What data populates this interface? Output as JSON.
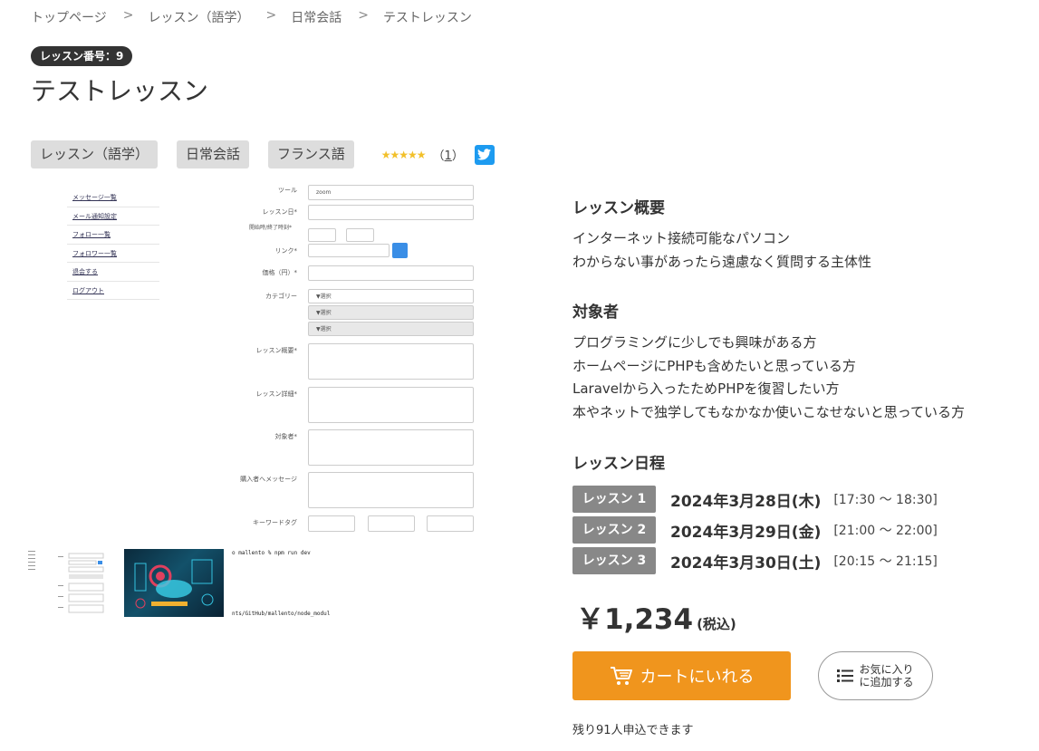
{
  "breadcrumb": [
    "トップページ",
    "レッスン（語学）",
    "日常会話",
    "テストレッスン"
  ],
  "breadcrumb_separator": ">",
  "lesson_number": "レッスン番号：9",
  "title": "テストレッスン",
  "tags": [
    "レッスン（語学）",
    "日常会話",
    "フランス語"
  ],
  "rating": {
    "stars": "★★★★★",
    "score": 5,
    "count_prefix": "（",
    "count": "1",
    "count_suffix": "）"
  },
  "main_image": {
    "sidebar": [
      "メッセージ一覧",
      "メール通知設定",
      "フォロー一覧",
      "フォロワー一覧",
      "退会する",
      "ログアウト"
    ],
    "fields": [
      {
        "label": "ツール",
        "value": "zoom"
      },
      {
        "label": "レッスン日*",
        "value": ""
      },
      {
        "label": "開始時/終了時刻*",
        "value": "~"
      },
      {
        "label": "リンク*",
        "value": ""
      },
      {
        "label": "価格（円）*",
        "value": ""
      },
      {
        "label": "カテゴリー",
        "value": "▼選択"
      },
      {
        "label": "",
        "value": "▼選択"
      },
      {
        "label": "",
        "value": "▼選択"
      },
      {
        "label": "レッスン概要*",
        "value": ""
      },
      {
        "label": "レッスン詳細*",
        "value": ""
      },
      {
        "label": "対象者*",
        "value": ""
      },
      {
        "label": "購入者へメッセージ",
        "value": ""
      },
      {
        "label": "キーワードタグ",
        "value": ""
      }
    ]
  },
  "thumb_terminal": {
    "line1": "o mallento % npm run dev",
    "line2": "nts/GitHub/mallento/node_modul"
  },
  "overview": {
    "title": "レッスン概要",
    "lines": [
      "インターネット接続可能なパソコン",
      "わからない事があったら遠慮なく質問する主体性"
    ]
  },
  "target": {
    "title": "対象者",
    "lines": [
      "プログラミングに少しでも興味がある方",
      "ホームページにPHPも含めたいと思っている方",
      "Laravelから入ったためPHPを復習したい方",
      "本やネットで独学してもなかなか使いこなせないと思っている方"
    ]
  },
  "schedule": {
    "title": "レッスン日程",
    "items": [
      {
        "badge": "レッスン 1",
        "date": "2024年3月28日(木)",
        "time": "[17:30 〜 18:30]"
      },
      {
        "badge": "レッスン 2",
        "date": "2024年3月29日(金)",
        "time": "[21:00 〜 22:00]"
      },
      {
        "badge": "レッスン 3",
        "date": "2024年3月30日(土)",
        "time": "[20:15 〜 21:15]"
      }
    ]
  },
  "price": {
    "amount": "￥1,234",
    "tax": "(税込)"
  },
  "cart_button": {
    "label": "カートにいれる",
    "icon": "cart-icon"
  },
  "favorite_button": {
    "line1": "お気に入り",
    "line2": "に追加する",
    "icon": "list-icon"
  },
  "remaining": "残り91人申込できます",
  "colors": {
    "accent": "#f0951d",
    "badge": "#888888",
    "twitter": "#1d9bf0",
    "star": "#f2c02a"
  }
}
